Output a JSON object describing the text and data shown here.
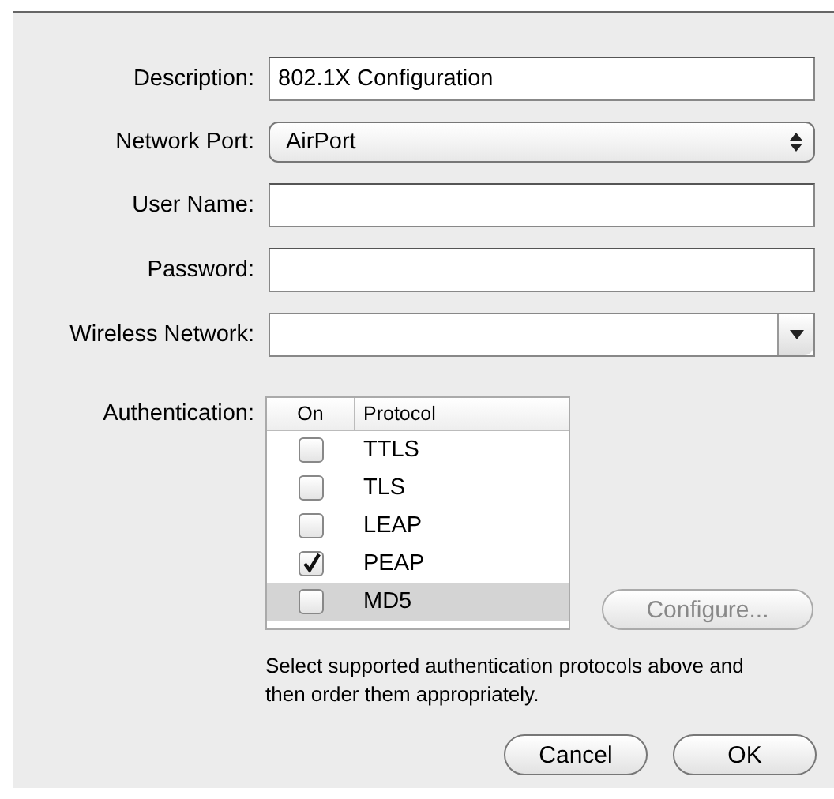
{
  "fields": [
    {
      "kind": "text",
      "label": "Description:",
      "value": "802.1X Configuration"
    },
    {
      "kind": "popup",
      "label": "Network Port:",
      "value": "AirPort"
    },
    {
      "kind": "text",
      "label": "User Name:"
    },
    {
      "kind": "password",
      "label": "Password:"
    },
    {
      "kind": "combo",
      "label": "Wireless Network:"
    }
  ],
  "authentication": {
    "label": "Authentication:",
    "columns": [
      "On",
      "Protocol"
    ],
    "rows": [
      {
        "protocol": "TTLS",
        "checked": false,
        "selected": false
      },
      {
        "protocol": "TLS",
        "checked": false,
        "selected": false
      },
      {
        "protocol": "LEAP",
        "checked": false,
        "selected": false
      },
      {
        "protocol": "PEAP",
        "checked": true,
        "selected": false
      },
      {
        "protocol": "MD5",
        "checked": false,
        "selected": true
      }
    ],
    "configure_button": {
      "label": "Configure...",
      "disabled": true
    },
    "help": "Select supported authentication protocols above and then order them appropriately."
  },
  "buttons": [
    "Cancel",
    "OK"
  ]
}
